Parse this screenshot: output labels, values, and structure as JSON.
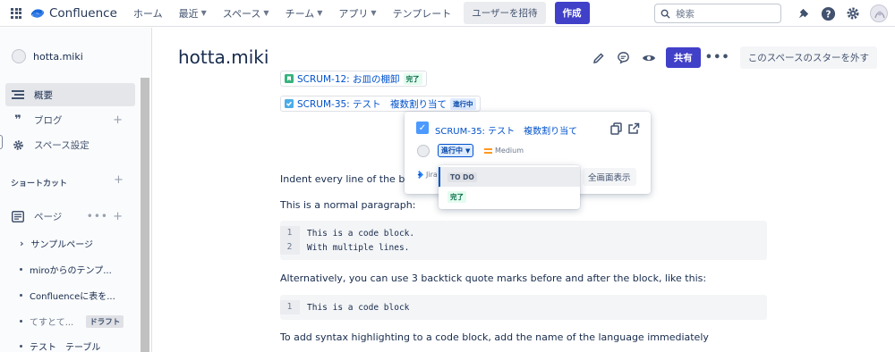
{
  "topnav": {
    "logo": "Confluence",
    "items": [
      {
        "label": "ホーム",
        "chevron": false
      },
      {
        "label": "最近",
        "chevron": true
      },
      {
        "label": "スペース",
        "chevron": true
      },
      {
        "label": "チーム",
        "chevron": true
      },
      {
        "label": "アプリ",
        "chevron": true
      },
      {
        "label": "テンプレート",
        "chevron": false
      }
    ],
    "invite_label": "ユーザーを招待",
    "create_label": "作成",
    "search_placeholder": "検索",
    "accent": "#4140c9"
  },
  "sidebar": {
    "space_name": "hotta.miki",
    "items": [
      {
        "label": "概要",
        "icon": "overview-icon"
      },
      {
        "label": "ブログ",
        "icon": "quote-icon"
      },
      {
        "label": "スペース設定",
        "icon": "gear-icon"
      }
    ],
    "shortcut_label": "ショートカット",
    "pages_label": "ページ",
    "pages": [
      {
        "label": "サンプルページ",
        "marker": "›"
      },
      {
        "label": "miroからのテンプ...",
        "marker": "•"
      },
      {
        "label": "Confluenceに表を...",
        "marker": "•"
      },
      {
        "label": "てすとて...",
        "marker": "•",
        "badge": "ドラフト"
      },
      {
        "label": "テスト　テーブル",
        "marker": "•"
      }
    ]
  },
  "main": {
    "title": "hotta.miki",
    "share_label": "共有",
    "unstar_label": "このスペースのスターを外す",
    "issues": [
      {
        "key": "SCRUM-12: お皿の棚卸",
        "status": "完了"
      },
      {
        "key": "SCRUM-35: テスト　複数割り当て",
        "status": "進行中"
      }
    ],
    "para1": "Indent every line of the block by at least 4 spaces.",
    "para2": "This is a normal paragraph:",
    "code1": [
      "This is a code block.",
      "With multiple lines."
    ],
    "para3": "Alternatively, you can use 3 backtick quote marks before and after the block, like this:",
    "code2": [
      "This is a code block"
    ],
    "para4": "To add syntax highlighting to a code block, add the name of the language immediately"
  },
  "popup": {
    "title": "SCRUM-35: テスト　複数割り当て",
    "status": "進行中",
    "priority": "Medium",
    "jira_label": "Jira",
    "fullscreen_label": "全画面表示",
    "dropdown": [
      {
        "label": "TO DO"
      },
      {
        "label": "完了"
      }
    ]
  }
}
